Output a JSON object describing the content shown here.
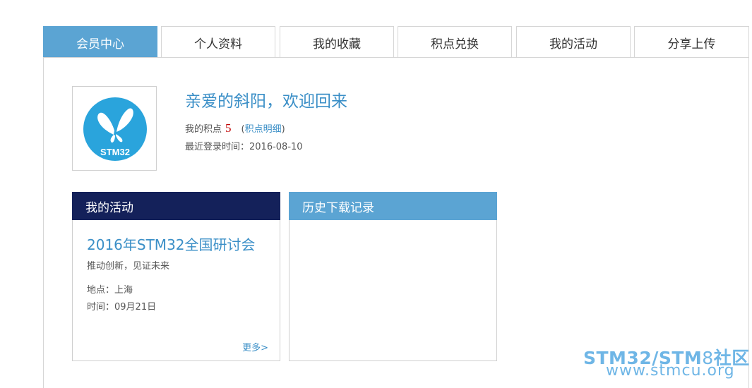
{
  "tabs": [
    {
      "label": "会员中心",
      "active": true
    },
    {
      "label": "个人资料",
      "active": false
    },
    {
      "label": "我的收藏",
      "active": false
    },
    {
      "label": "积点兑换",
      "active": false
    },
    {
      "label": "我的活动",
      "active": false
    },
    {
      "label": "分享上传",
      "active": false
    }
  ],
  "profile": {
    "logo_text": "STM32",
    "welcome": "亲爱的斜阳，欢迎回来",
    "points_label": "我的积点",
    "points_value": "5",
    "points_paren_open": "(",
    "points_link": "积点明细",
    "points_paren_close": ")",
    "last_login": "最近登录时间：2016-08-10"
  },
  "activity_card": {
    "title": "我的活动",
    "event_title": "2016年STM32全国研讨会",
    "event_subtitle": "推动创新，见证未来",
    "event_place": "地点：上海",
    "event_time": "时间：09月21日",
    "more": "更多>"
  },
  "download_card": {
    "title": "历史下载记录"
  },
  "watermark": {
    "line1_a": "STM32/STM",
    "line1_b": "8",
    "line1_c": "社区",
    "line2": "www.stmcu.org"
  },
  "colors": {
    "accent": "#5ba4d3",
    "navy": "#14215a",
    "link": "#3b8fc7",
    "points": "#c00000"
  }
}
